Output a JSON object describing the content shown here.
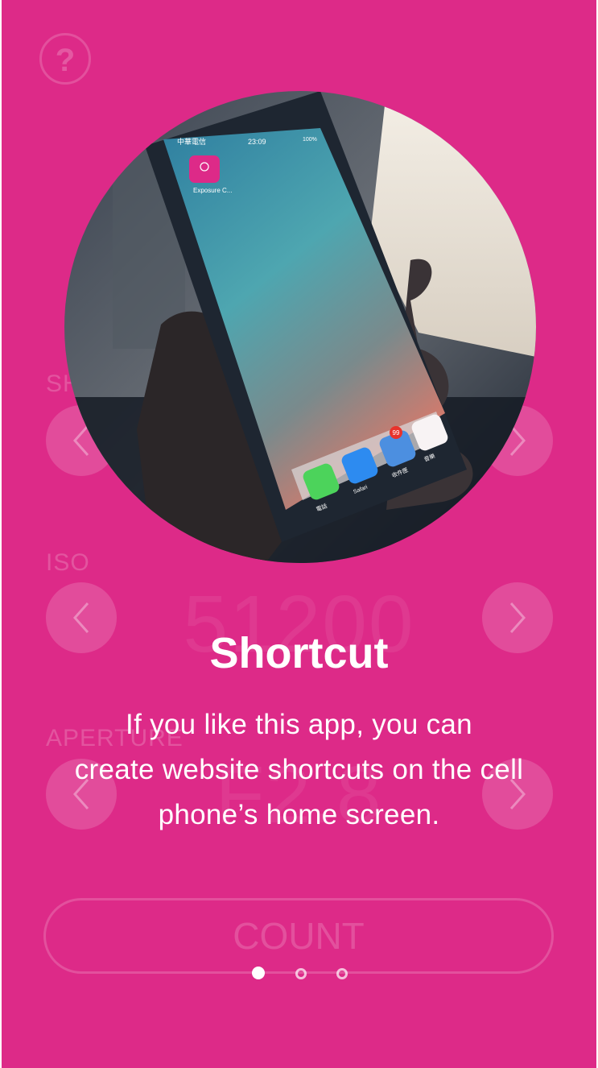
{
  "background_app": {
    "help_label": "?",
    "shutter_label": "SH",
    "iso_label": "ISO",
    "iso_value": "51200",
    "aperture_label": "APERTURE",
    "aperture_value": "F2.8",
    "count_button_label": "COUNT"
  },
  "onboarding": {
    "title": "Shortcut",
    "description_line1": "If you like this app, you can",
    "description_line2": "create website shortcuts on the cell",
    "description_line3": "phone’s home screen.",
    "current_page": 1,
    "total_pages": 3
  },
  "phone_screen": {
    "carrier": "中華電信",
    "time": "23:09",
    "battery": "100%",
    "app_icon_label": "Exposure C...",
    "badge_count": "99",
    "dock_labels": [
      "電話",
      "Safari",
      "收件匣",
      "音樂"
    ]
  },
  "colors": {
    "background": "#dd2a88",
    "foreground": "#ffffff"
  }
}
